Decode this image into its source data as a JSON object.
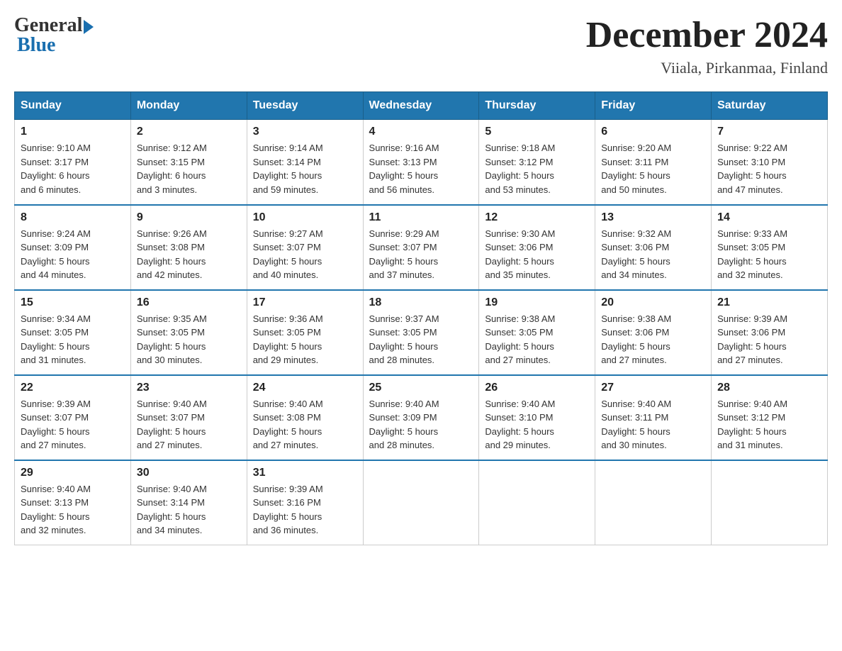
{
  "logo": {
    "general": "General",
    "blue": "Blue"
  },
  "title": "December 2024",
  "location": "Viiala, Pirkanmaa, Finland",
  "weekdays": [
    "Sunday",
    "Monday",
    "Tuesday",
    "Wednesday",
    "Thursday",
    "Friday",
    "Saturday"
  ],
  "weeks": [
    [
      {
        "day": "1",
        "sunrise": "9:10 AM",
        "sunset": "3:17 PM",
        "daylight": "6 hours and 6 minutes."
      },
      {
        "day": "2",
        "sunrise": "9:12 AM",
        "sunset": "3:15 PM",
        "daylight": "6 hours and 3 minutes."
      },
      {
        "day": "3",
        "sunrise": "9:14 AM",
        "sunset": "3:14 PM",
        "daylight": "5 hours and 59 minutes."
      },
      {
        "day": "4",
        "sunrise": "9:16 AM",
        "sunset": "3:13 PM",
        "daylight": "5 hours and 56 minutes."
      },
      {
        "day": "5",
        "sunrise": "9:18 AM",
        "sunset": "3:12 PM",
        "daylight": "5 hours and 53 minutes."
      },
      {
        "day": "6",
        "sunrise": "9:20 AM",
        "sunset": "3:11 PM",
        "daylight": "5 hours and 50 minutes."
      },
      {
        "day": "7",
        "sunrise": "9:22 AM",
        "sunset": "3:10 PM",
        "daylight": "5 hours and 47 minutes."
      }
    ],
    [
      {
        "day": "8",
        "sunrise": "9:24 AM",
        "sunset": "3:09 PM",
        "daylight": "5 hours and 44 minutes."
      },
      {
        "day": "9",
        "sunrise": "9:26 AM",
        "sunset": "3:08 PM",
        "daylight": "5 hours and 42 minutes."
      },
      {
        "day": "10",
        "sunrise": "9:27 AM",
        "sunset": "3:07 PM",
        "daylight": "5 hours and 40 minutes."
      },
      {
        "day": "11",
        "sunrise": "9:29 AM",
        "sunset": "3:07 PM",
        "daylight": "5 hours and 37 minutes."
      },
      {
        "day": "12",
        "sunrise": "9:30 AM",
        "sunset": "3:06 PM",
        "daylight": "5 hours and 35 minutes."
      },
      {
        "day": "13",
        "sunrise": "9:32 AM",
        "sunset": "3:06 PM",
        "daylight": "5 hours and 34 minutes."
      },
      {
        "day": "14",
        "sunrise": "9:33 AM",
        "sunset": "3:05 PM",
        "daylight": "5 hours and 32 minutes."
      }
    ],
    [
      {
        "day": "15",
        "sunrise": "9:34 AM",
        "sunset": "3:05 PM",
        "daylight": "5 hours and 31 minutes."
      },
      {
        "day": "16",
        "sunrise": "9:35 AM",
        "sunset": "3:05 PM",
        "daylight": "5 hours and 30 minutes."
      },
      {
        "day": "17",
        "sunrise": "9:36 AM",
        "sunset": "3:05 PM",
        "daylight": "5 hours and 29 minutes."
      },
      {
        "day": "18",
        "sunrise": "9:37 AM",
        "sunset": "3:05 PM",
        "daylight": "5 hours and 28 minutes."
      },
      {
        "day": "19",
        "sunrise": "9:38 AM",
        "sunset": "3:05 PM",
        "daylight": "5 hours and 27 minutes."
      },
      {
        "day": "20",
        "sunrise": "9:38 AM",
        "sunset": "3:06 PM",
        "daylight": "5 hours and 27 minutes."
      },
      {
        "day": "21",
        "sunrise": "9:39 AM",
        "sunset": "3:06 PM",
        "daylight": "5 hours and 27 minutes."
      }
    ],
    [
      {
        "day": "22",
        "sunrise": "9:39 AM",
        "sunset": "3:07 PM",
        "daylight": "5 hours and 27 minutes."
      },
      {
        "day": "23",
        "sunrise": "9:40 AM",
        "sunset": "3:07 PM",
        "daylight": "5 hours and 27 minutes."
      },
      {
        "day": "24",
        "sunrise": "9:40 AM",
        "sunset": "3:08 PM",
        "daylight": "5 hours and 27 minutes."
      },
      {
        "day": "25",
        "sunrise": "9:40 AM",
        "sunset": "3:09 PM",
        "daylight": "5 hours and 28 minutes."
      },
      {
        "day": "26",
        "sunrise": "9:40 AM",
        "sunset": "3:10 PM",
        "daylight": "5 hours and 29 minutes."
      },
      {
        "day": "27",
        "sunrise": "9:40 AM",
        "sunset": "3:11 PM",
        "daylight": "5 hours and 30 minutes."
      },
      {
        "day": "28",
        "sunrise": "9:40 AM",
        "sunset": "3:12 PM",
        "daylight": "5 hours and 31 minutes."
      }
    ],
    [
      {
        "day": "29",
        "sunrise": "9:40 AM",
        "sunset": "3:13 PM",
        "daylight": "5 hours and 32 minutes."
      },
      {
        "day": "30",
        "sunrise": "9:40 AM",
        "sunset": "3:14 PM",
        "daylight": "5 hours and 34 minutes."
      },
      {
        "day": "31",
        "sunrise": "9:39 AM",
        "sunset": "3:16 PM",
        "daylight": "5 hours and 36 minutes."
      },
      null,
      null,
      null,
      null
    ]
  ],
  "labels": {
    "sunrise": "Sunrise:",
    "sunset": "Sunset:",
    "daylight": "Daylight:"
  }
}
